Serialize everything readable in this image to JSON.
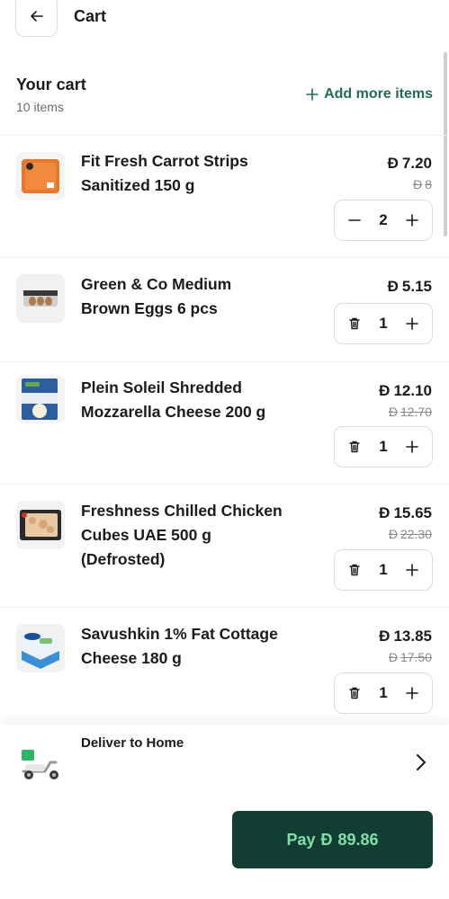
{
  "header": {
    "title": "Cart"
  },
  "summary": {
    "title": "Your cart",
    "count": "10 items",
    "add_more": "Add more items"
  },
  "currency_symbol": "Đ",
  "items": [
    {
      "name_line1": "Fit Fresh Carrot Strips",
      "name_line2": "Sanitized 150 g",
      "name_line3": "",
      "price": "7.20",
      "old_price": "8",
      "qty": "2"
    },
    {
      "name_line1": "Green & Co Medium",
      "name_line2": "Brown Eggs 6 pcs",
      "name_line3": "",
      "price": "5.15",
      "old_price": "",
      "qty": "1"
    },
    {
      "name_line1": "Plein Soleil Shredded",
      "name_line2": "Mozzarella Cheese 200 g",
      "name_line3": "",
      "price": "12.10",
      "old_price": "12.70",
      "qty": "1"
    },
    {
      "name_line1": "Freshness Chilled Chicken",
      "name_line2": "Cubes UAE 500 g",
      "name_line3": "(Defrosted)",
      "price": "15.65",
      "old_price": "22.30",
      "qty": "1"
    },
    {
      "name_line1": "Savushkin 1% Fat Cottage",
      "name_line2": "Cheese 180 g",
      "name_line3": "",
      "price": "13.85",
      "old_price": "17.50",
      "qty": "1"
    }
  ],
  "delivery": {
    "title": "Deliver to Home"
  },
  "pay": {
    "label": "Pay",
    "amount": "89.86"
  },
  "colors": {
    "accent_green": "#1f6e4c",
    "pay_bg": "#113d33",
    "pay_text": "#7fe0a6"
  }
}
